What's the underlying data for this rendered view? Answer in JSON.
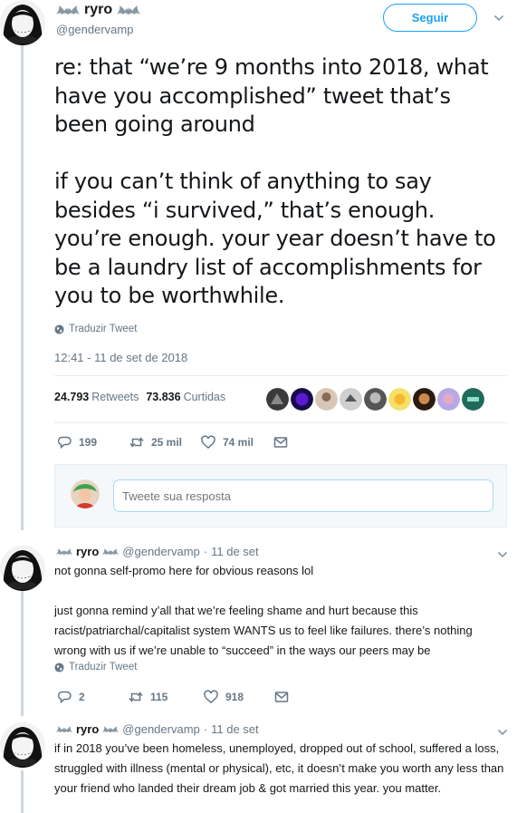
{
  "main_tweet": {
    "display_name": "ryro",
    "handle": "@gendervamp",
    "follow_label": "Seguir",
    "text": "re: that “we’re 9 months into 2018, what have you accomplished” tweet that’s been going around\n\nif you can’t think of anything to say besides “i survived,” that’s enough. you’re enough. your year doesn’t have to be a laundry list of accomplishments for you to be worthwhile.",
    "translate_label": "Traduzir Tweet",
    "timestamp": "12:41 - 11 de set de 2018",
    "retweets_count": "24.793",
    "retweets_label": "Retweets",
    "likes_count": "73.836",
    "likes_label": "Curtidas",
    "actions": {
      "replies": "199",
      "retweets": "25 mil",
      "likes": "74 mil"
    }
  },
  "reply_box": {
    "placeholder": "Tweete sua resposta"
  },
  "replies": [
    {
      "display_name": "ryro",
      "handle": "@gendervamp",
      "date": "11 de set",
      "paragraphs": [
        "not gonna self-promo here for obvious reasons lol",
        "just gonna remind y’all that we’re feeling shame and hurt because this racist/patriarchal/capitalist system WANTS us to feel like failures. there’s nothing wrong with us if we’re unable to “succeed” in the ways our peers may be"
      ],
      "translate_label": "Traduzir Tweet",
      "actions": {
        "replies": "2",
        "retweets": "115",
        "likes": "918"
      }
    },
    {
      "display_name": "ryro",
      "handle": "@gendervamp",
      "date": "11 de set",
      "paragraphs": [
        "if in 2018 you’ve been homeless, unemployed, dropped out of school, suffered a loss, struggled with illness (mental or physical), etc, it doesn’t make you worth any less than your friend who landed their dream job & got married this year. you matter."
      ]
    }
  ],
  "colors": {
    "accent": "#1da1f2",
    "muted": "#657786",
    "text": "#14171a",
    "thread_line": "#ccd6dd"
  },
  "icons": [
    "bat-icon",
    "chevron-down-icon",
    "globe-icon",
    "reply-icon",
    "retweet-icon",
    "heart-icon",
    "message-icon"
  ]
}
